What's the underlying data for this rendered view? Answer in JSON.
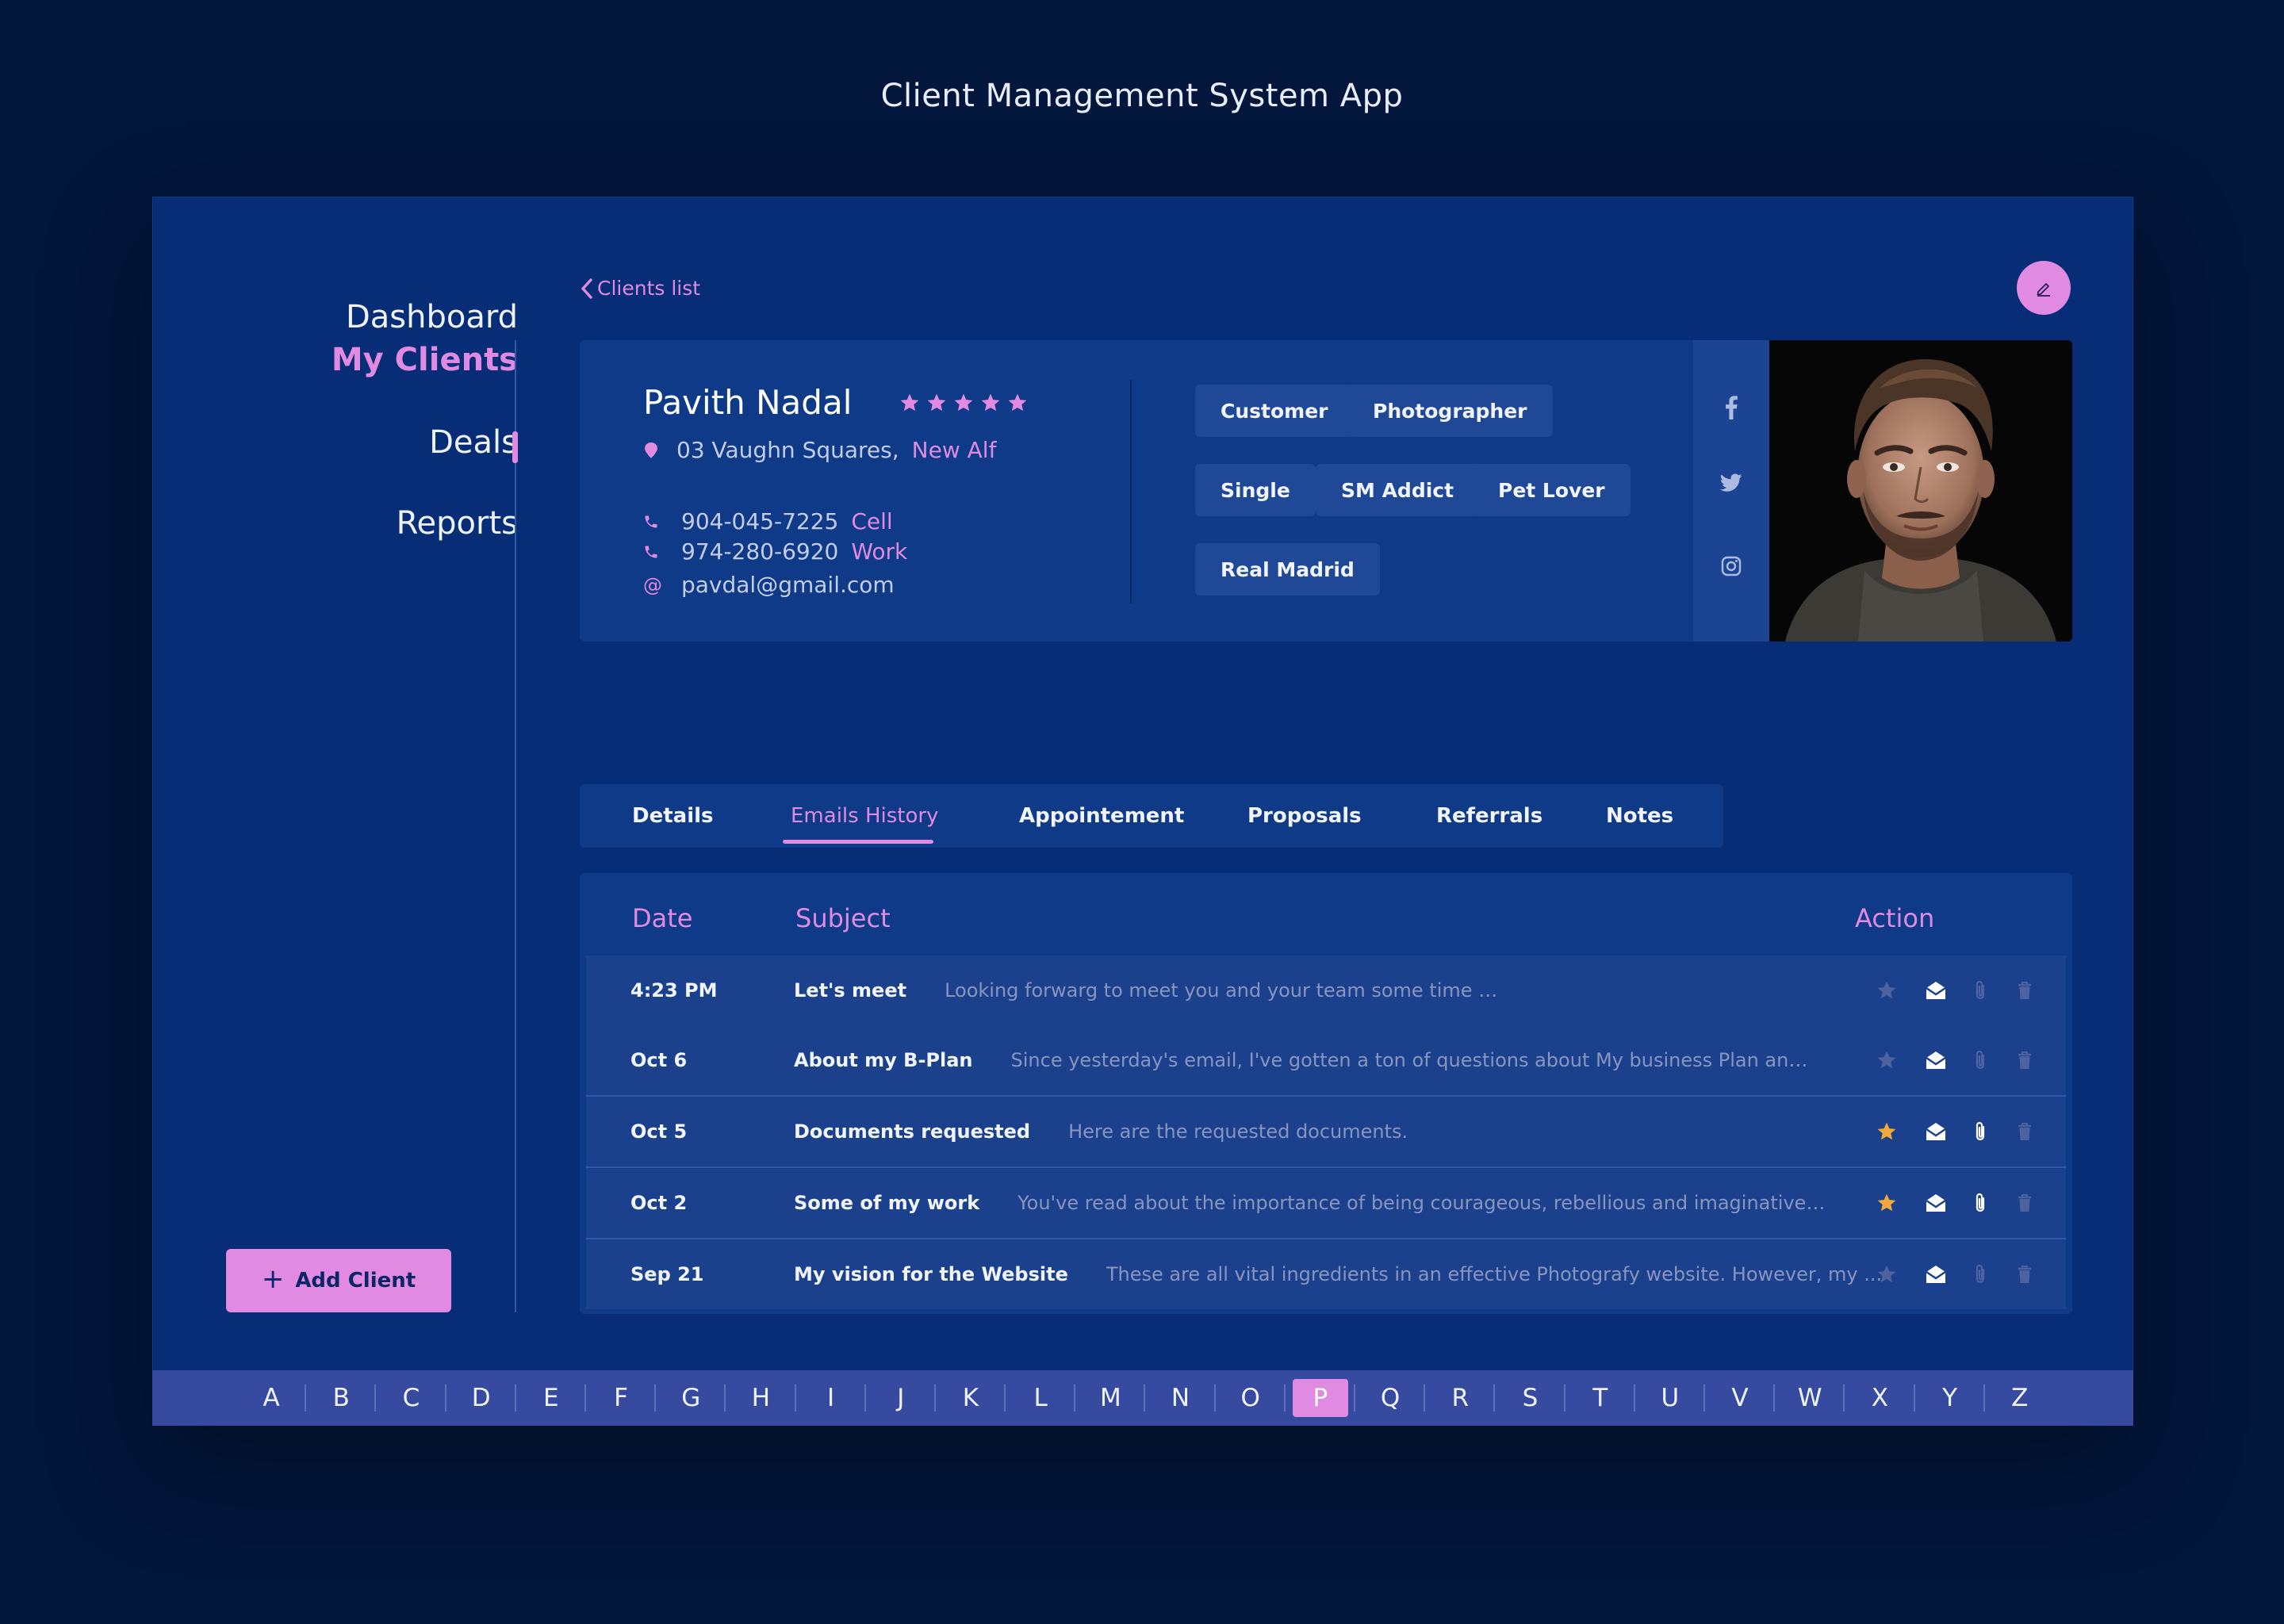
{
  "page_title": "Client Management System App",
  "colors": {
    "accent": "#e08be1",
    "background": "#062d75",
    "card": "#0e3a87",
    "star_active": "#f2a93b"
  },
  "sidebar": {
    "items": [
      {
        "label": "Dashboard",
        "active": false
      },
      {
        "label": "My Clients",
        "active": true
      },
      {
        "label": "Deals",
        "active": false
      },
      {
        "label": "Reports",
        "active": false
      }
    ],
    "add_button": {
      "icon": "plus-icon",
      "label": "Add Client"
    }
  },
  "header": {
    "back_label": "Clients list",
    "edit_icon": "pencil-icon"
  },
  "profile": {
    "name": "Pavith Nadal",
    "rating": 5,
    "address": {
      "street": "03 Vaughn Squares,",
      "city": "New Alf"
    },
    "phones": [
      {
        "number": "904-045-7225",
        "label": "Cell"
      },
      {
        "number": "974-280-6920",
        "label": "Work"
      }
    ],
    "email_symbol": "@",
    "email": "pavdal@gmail.com",
    "tags": [
      "Customer",
      "Photographer",
      "Single",
      "SM Addict",
      "Pet Lover",
      "Real Madrid"
    ],
    "social": [
      "facebook-icon",
      "twitter-icon",
      "instagram-icon"
    ]
  },
  "tabs": [
    {
      "label": "Details",
      "active": false
    },
    {
      "label": "Emails History",
      "active": true
    },
    {
      "label": "Appointement",
      "active": false
    },
    {
      "label": "Proposals",
      "active": false
    },
    {
      "label": "Referrals",
      "active": false
    },
    {
      "label": "Notes",
      "active": false
    }
  ],
  "emails": {
    "columns": {
      "date": "Date",
      "subject": "Subject",
      "action": "Action"
    },
    "rows": [
      {
        "date": "4:23 PM",
        "subject": "Let's meet",
        "preview": "Looking forwarg to meet you and your team some time soon.",
        "starred": false,
        "attachment": false
      },
      {
        "date": "Oct 6",
        "subject": "About my B-Plan",
        "preview": "Since yesterday's email, I've gotten a ton of questions about My business Plan and how ...",
        "starred": false,
        "attachment": false
      },
      {
        "date": "Oct 5",
        "subject": "Documents requested",
        "preview": "Here are the requested documents.",
        "starred": true,
        "attachment": true
      },
      {
        "date": "Oct 2",
        "subject": "Some of my work",
        "preview": "You've read about the importance of being courageous, rebellious and imaginative in ...",
        "starred": true,
        "attachment": true
      },
      {
        "date": "Sep 21",
        "subject": "My vision for the Website",
        "preview": "These are all vital ingredients in an effective Photografy website. However, my ...",
        "starred": false,
        "attachment": false
      }
    ]
  },
  "alphabet": {
    "letters": [
      "A",
      "B",
      "C",
      "D",
      "E",
      "F",
      "G",
      "H",
      "I",
      "J",
      "K",
      "L",
      "M",
      "N",
      "O",
      "P",
      "Q",
      "R",
      "S",
      "T",
      "U",
      "V",
      "W",
      "X",
      "Y",
      "Z"
    ],
    "selected": "P"
  }
}
